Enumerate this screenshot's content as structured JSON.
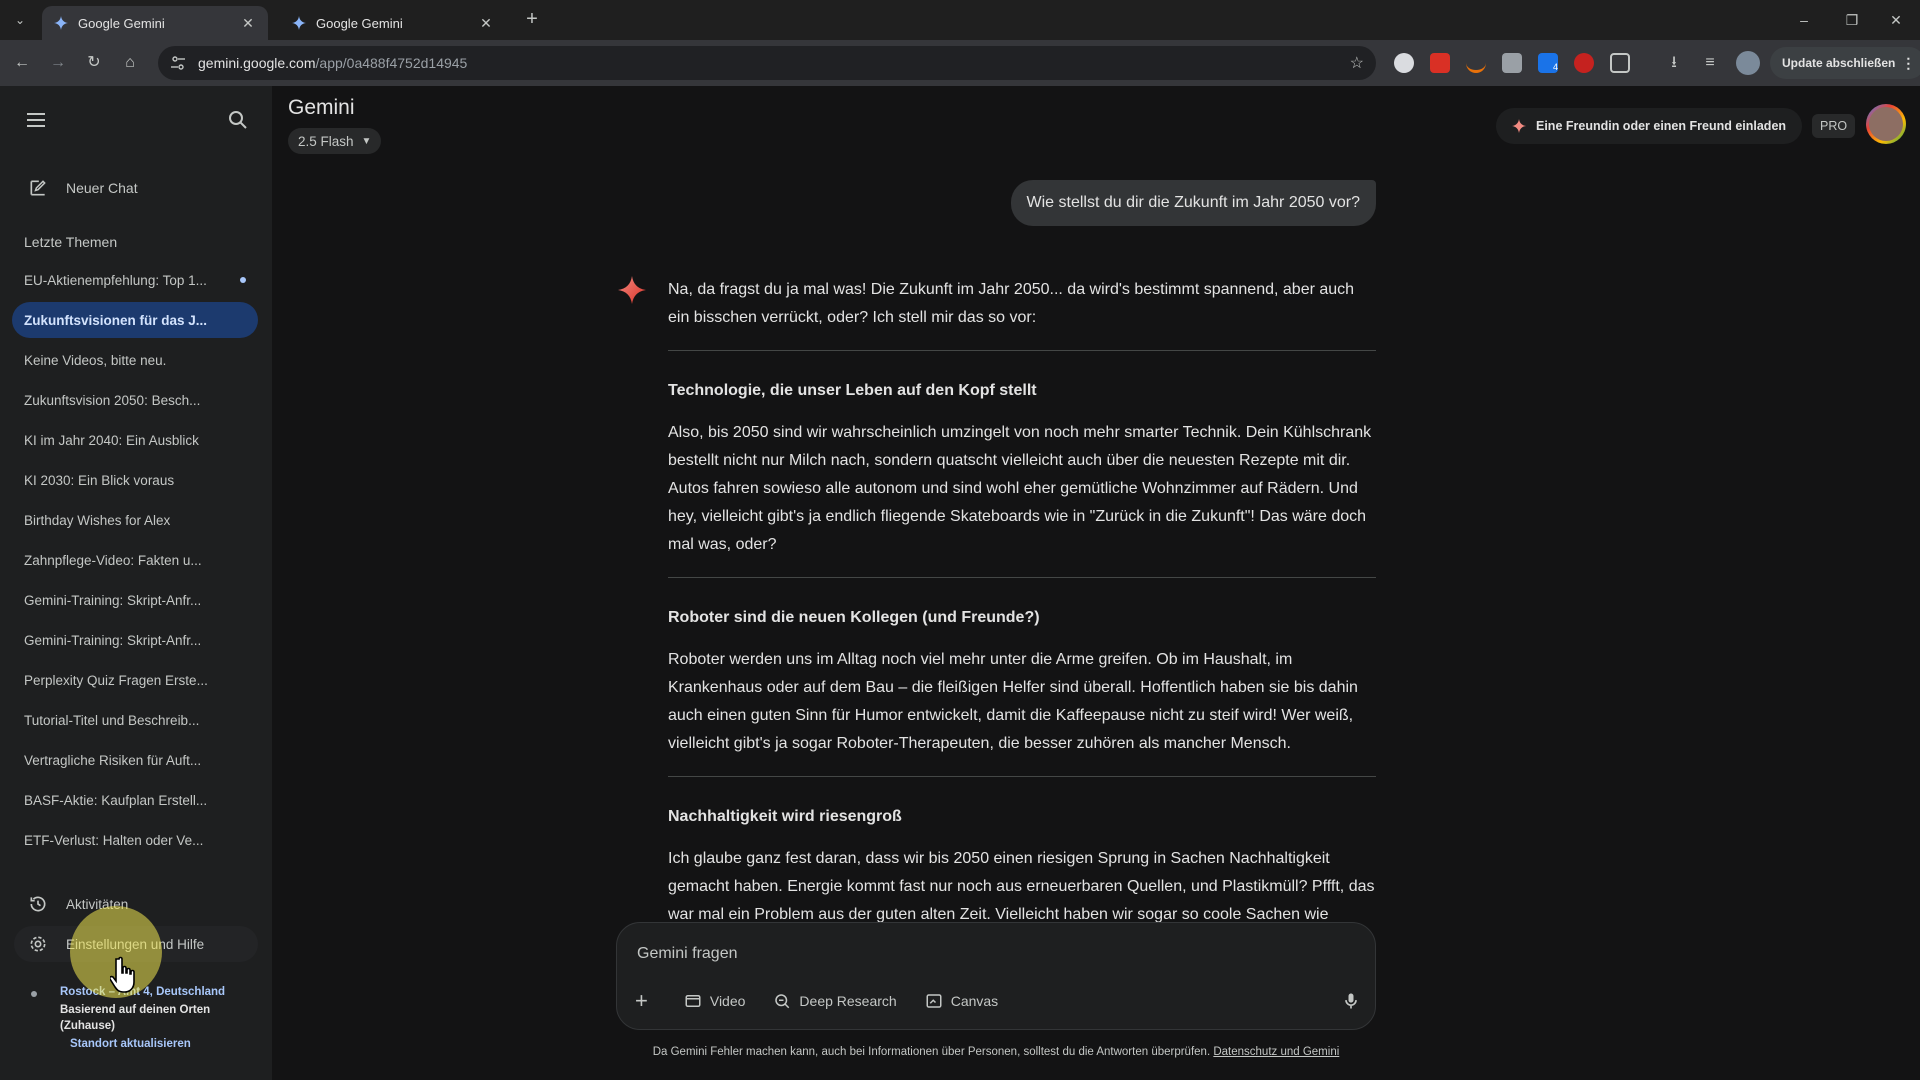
{
  "browser": {
    "tabs": [
      {
        "title": "Google Gemini",
        "active": true
      },
      {
        "title": "Google Gemini",
        "active": false
      }
    ],
    "url_host": "gemini.google.com",
    "url_path": "/app/0a488f4752d14945",
    "update_label": "Update abschließen",
    "extension_badge": "4"
  },
  "header": {
    "brand": "Gemini",
    "model": "2.5 Flash",
    "invite_label": "Eine Freundin oder einen Freund einladen",
    "pro_badge": "PRO"
  },
  "sidebar": {
    "new_chat": "Neuer Chat",
    "section_title": "Letzte Themen",
    "items": [
      {
        "label": "EU-Aktienempfehlung: Top 1...",
        "unread": true
      },
      {
        "label": "Zukunftsvisionen für das J...",
        "active": true
      },
      {
        "label": "Keine Videos, bitte neu."
      },
      {
        "label": "Zukunftsvision 2050: Besch..."
      },
      {
        "label": "KI im Jahr 2040: Ein Ausblick"
      },
      {
        "label": "KI 2030: Ein Blick voraus"
      },
      {
        "label": "Birthday Wishes for Alex"
      },
      {
        "label": "Zahnpflege-Video: Fakten u..."
      },
      {
        "label": "Gemini-Training: Skript-Anfr..."
      },
      {
        "label": "Gemini-Training: Skript-Anfr..."
      },
      {
        "label": "Perplexity Quiz Fragen Erste..."
      },
      {
        "label": "Tutorial-Titel und Beschreib..."
      },
      {
        "label": "Vertragliche Risiken für Auft..."
      },
      {
        "label": "BASF-Aktie: Kaufplan Erstell..."
      },
      {
        "label": "ETF-Verlust: Halten oder Ve..."
      }
    ],
    "activity": "Aktivitäten",
    "settings": "Einstellungen und Hilfe",
    "location": {
      "place": "Rostock – Amt 4, Deutschland",
      "basis": "Basierend auf deinen Orten (Zuhause)",
      "update": "Standort aktualisieren"
    }
  },
  "chat": {
    "user_message": "Wie stellst du dir die Zukunft im Jahr 2050 vor?",
    "intro": "Na, da fragst du ja mal was! Die Zukunft im Jahr 2050... da wird's bestimmt spannend, aber auch ein bisschen verrückt, oder? Ich stell mir das so vor:",
    "sections": [
      {
        "heading": "Technologie, die unser Leben auf den Kopf stellt",
        "body": "Also, bis 2050 sind wir wahrscheinlich umzingelt von noch mehr smarter Technik. Dein Kühlschrank bestellt nicht nur Milch nach, sondern quatscht vielleicht auch über die neuesten Rezepte mit dir. Autos fahren sowieso alle autonom und sind wohl eher gemütliche Wohnzimmer auf Rädern. Und hey, vielleicht gibt's ja endlich fliegende Skateboards wie in \"Zurück in die Zukunft\"! Das wäre doch mal was, oder?"
      },
      {
        "heading": "Roboter sind die neuen Kollegen (und Freunde?)",
        "body": "Roboter werden uns im Alltag noch viel mehr unter die Arme greifen. Ob im Haushalt, im Krankenhaus oder auf dem Bau – die fleißigen Helfer sind überall. Hoffentlich haben sie bis dahin auch einen guten Sinn für Humor entwickelt, damit die Kaffeepause nicht zu steif wird! Wer weiß, vielleicht gibt's ja sogar Roboter-Therapeuten, die besser zuhören als mancher Mensch."
      },
      {
        "heading": "Nachhaltigkeit wird riesengroß",
        "body": "Ich glaube ganz fest daran, dass wir bis 2050 einen riesigen Sprung in Sachen Nachhaltigkeit gemacht haben. Energie kommt fast nur noch aus erneuerbaren Quellen, und Plastikmüll? Pffft, das war mal ein Problem aus der guten alten Zeit. Vielleicht haben wir sogar so coole Sachen wie"
      }
    ]
  },
  "composer": {
    "placeholder": "Gemini fragen",
    "tools": [
      "Video",
      "Deep Research",
      "Canvas"
    ]
  },
  "footer": {
    "disclaimer": "Da Gemini Fehler machen kann, auch bei Informationen über Personen, solltest du die Antworten überprüfen.",
    "link": "Datenschutz und Gemini"
  },
  "colors": {
    "accent": "#a8c7fa",
    "active_item": "#1c3a6e",
    "background": "#131314",
    "sidebar": "#1e1f20"
  }
}
